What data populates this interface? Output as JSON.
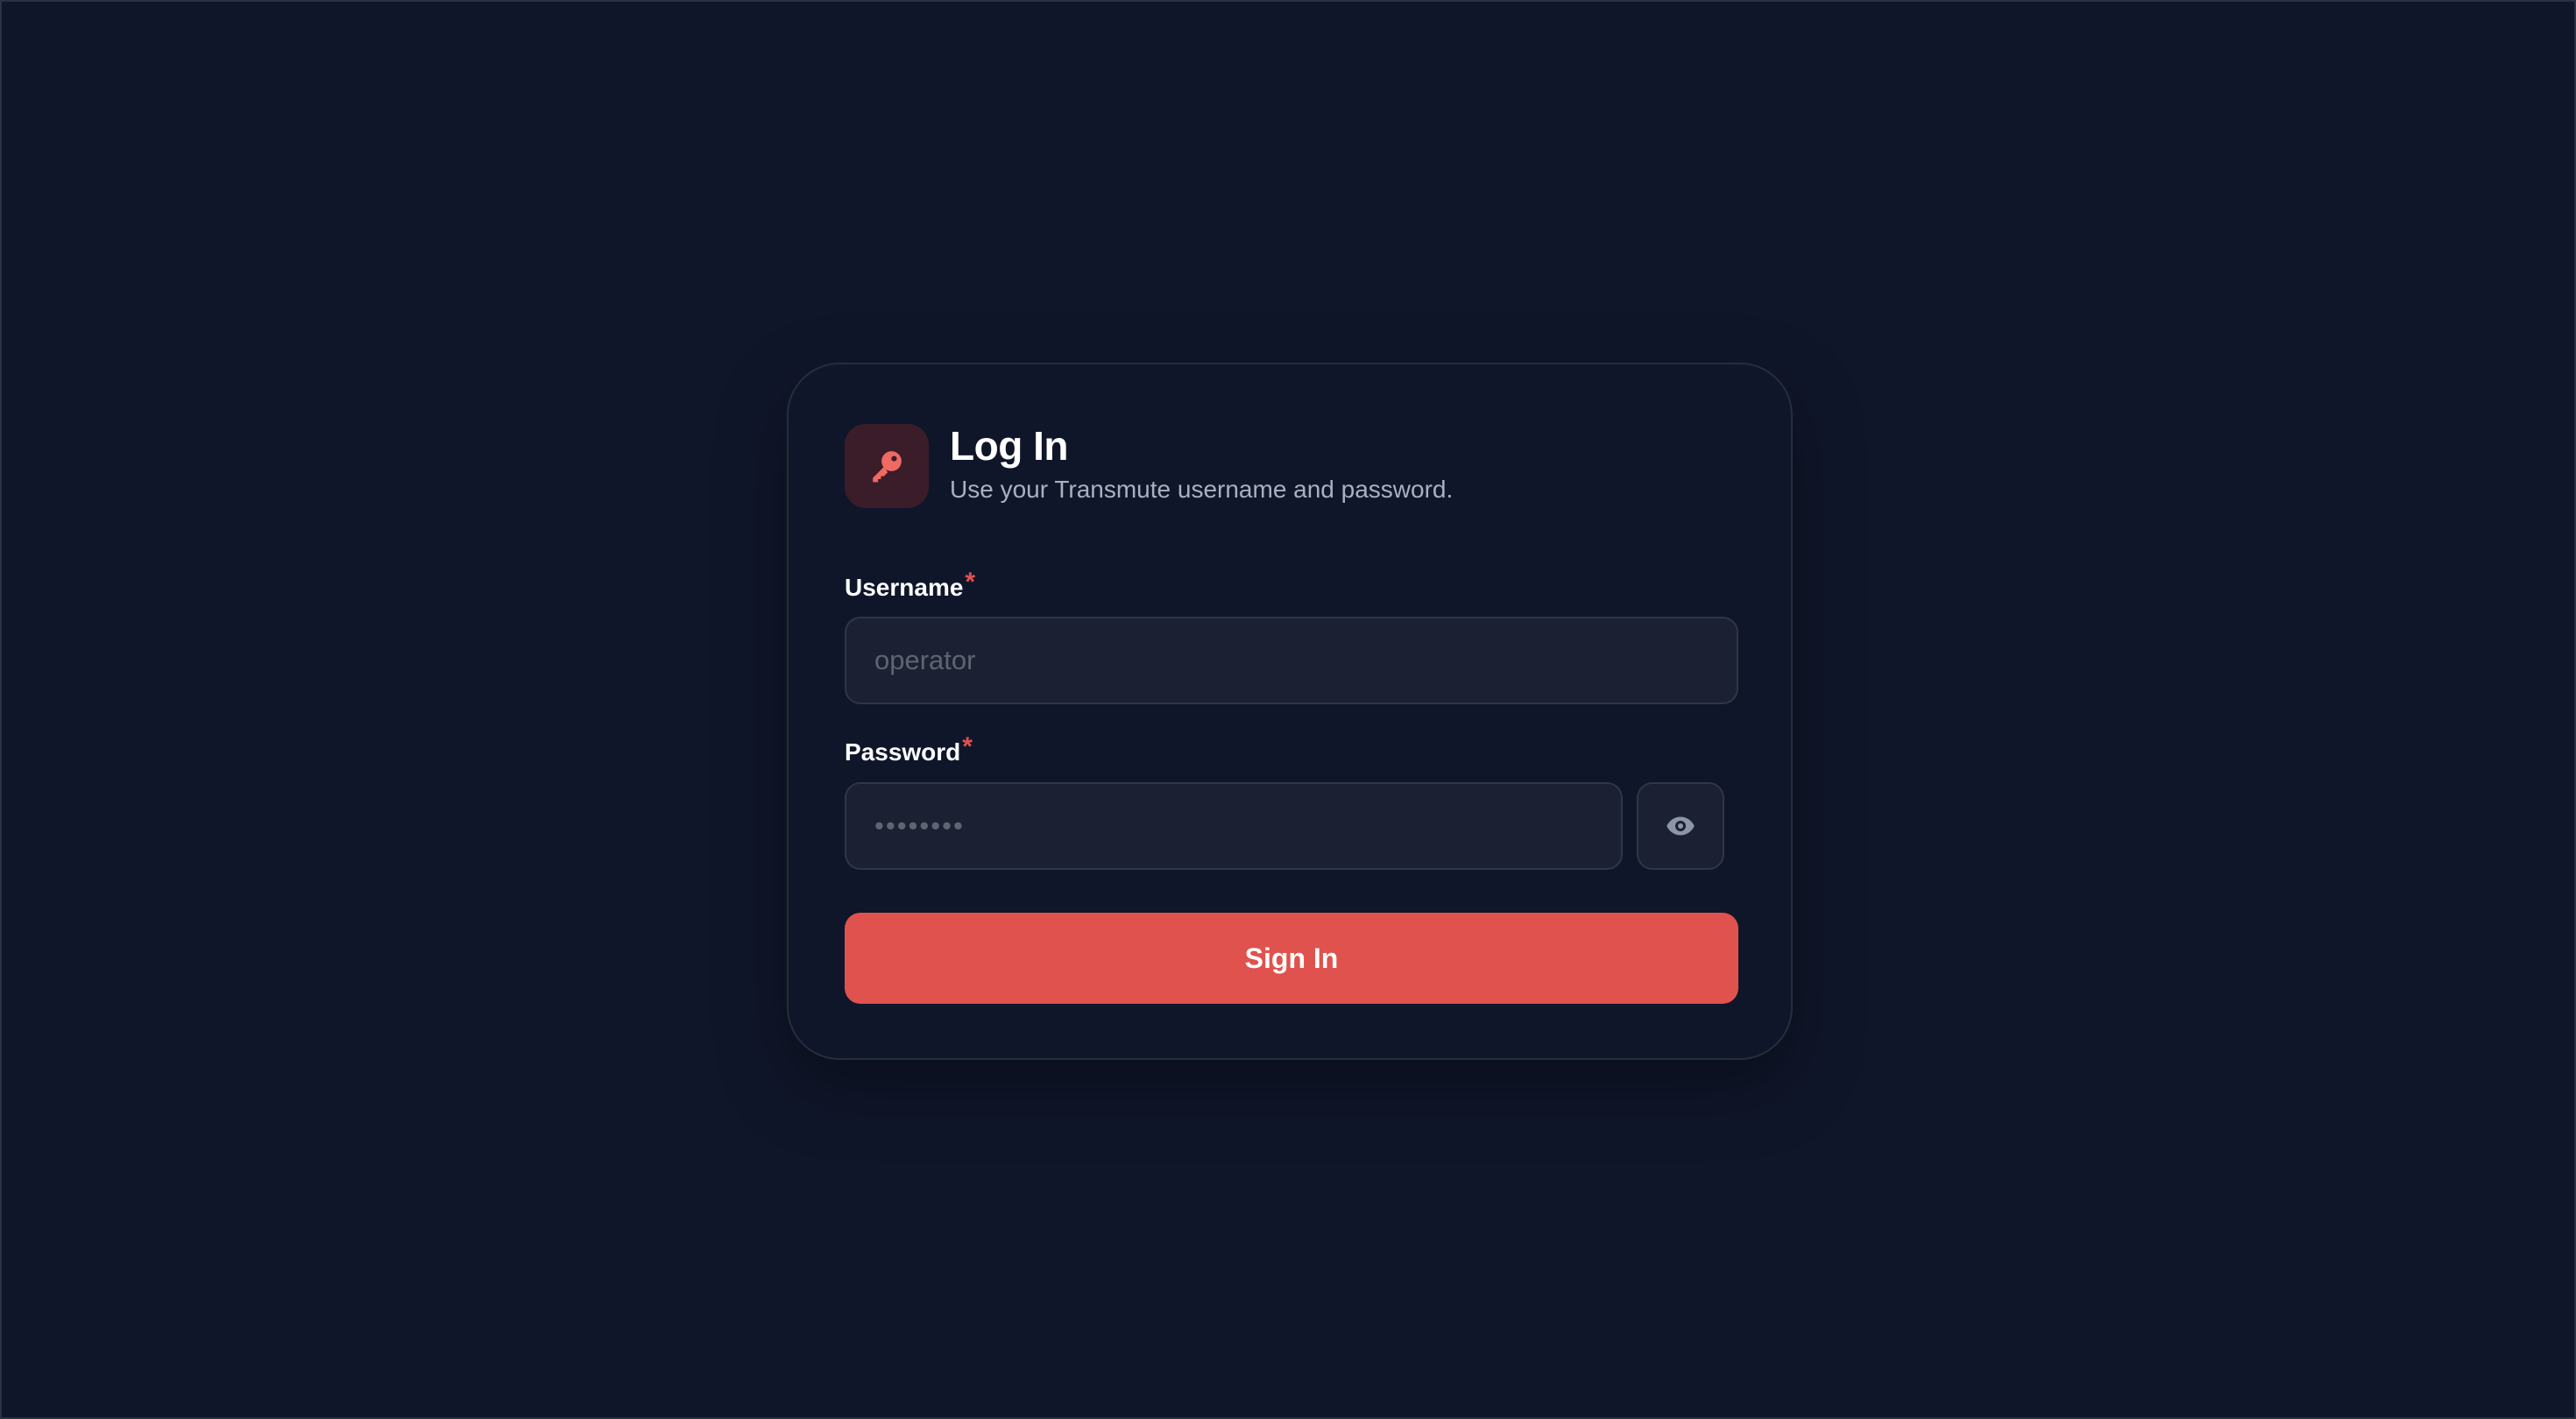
{
  "header": {
    "title": "Log In",
    "subtitle": "Use your Transmute username and password.",
    "icon": "key-icon"
  },
  "form": {
    "username": {
      "label": "Username",
      "required_marker": "*",
      "placeholder": "operator",
      "value": ""
    },
    "password": {
      "label": "Password",
      "required_marker": "*",
      "placeholder": "••••••••",
      "value": "",
      "toggle_icon": "eye-icon"
    },
    "submit_label": "Sign In"
  },
  "colors": {
    "background": "#10162a",
    "accent": "#e0524d",
    "icon_badge": "#3a1d29",
    "input_bg": "#1b2133",
    "subtitle": "#a9b0bf"
  }
}
